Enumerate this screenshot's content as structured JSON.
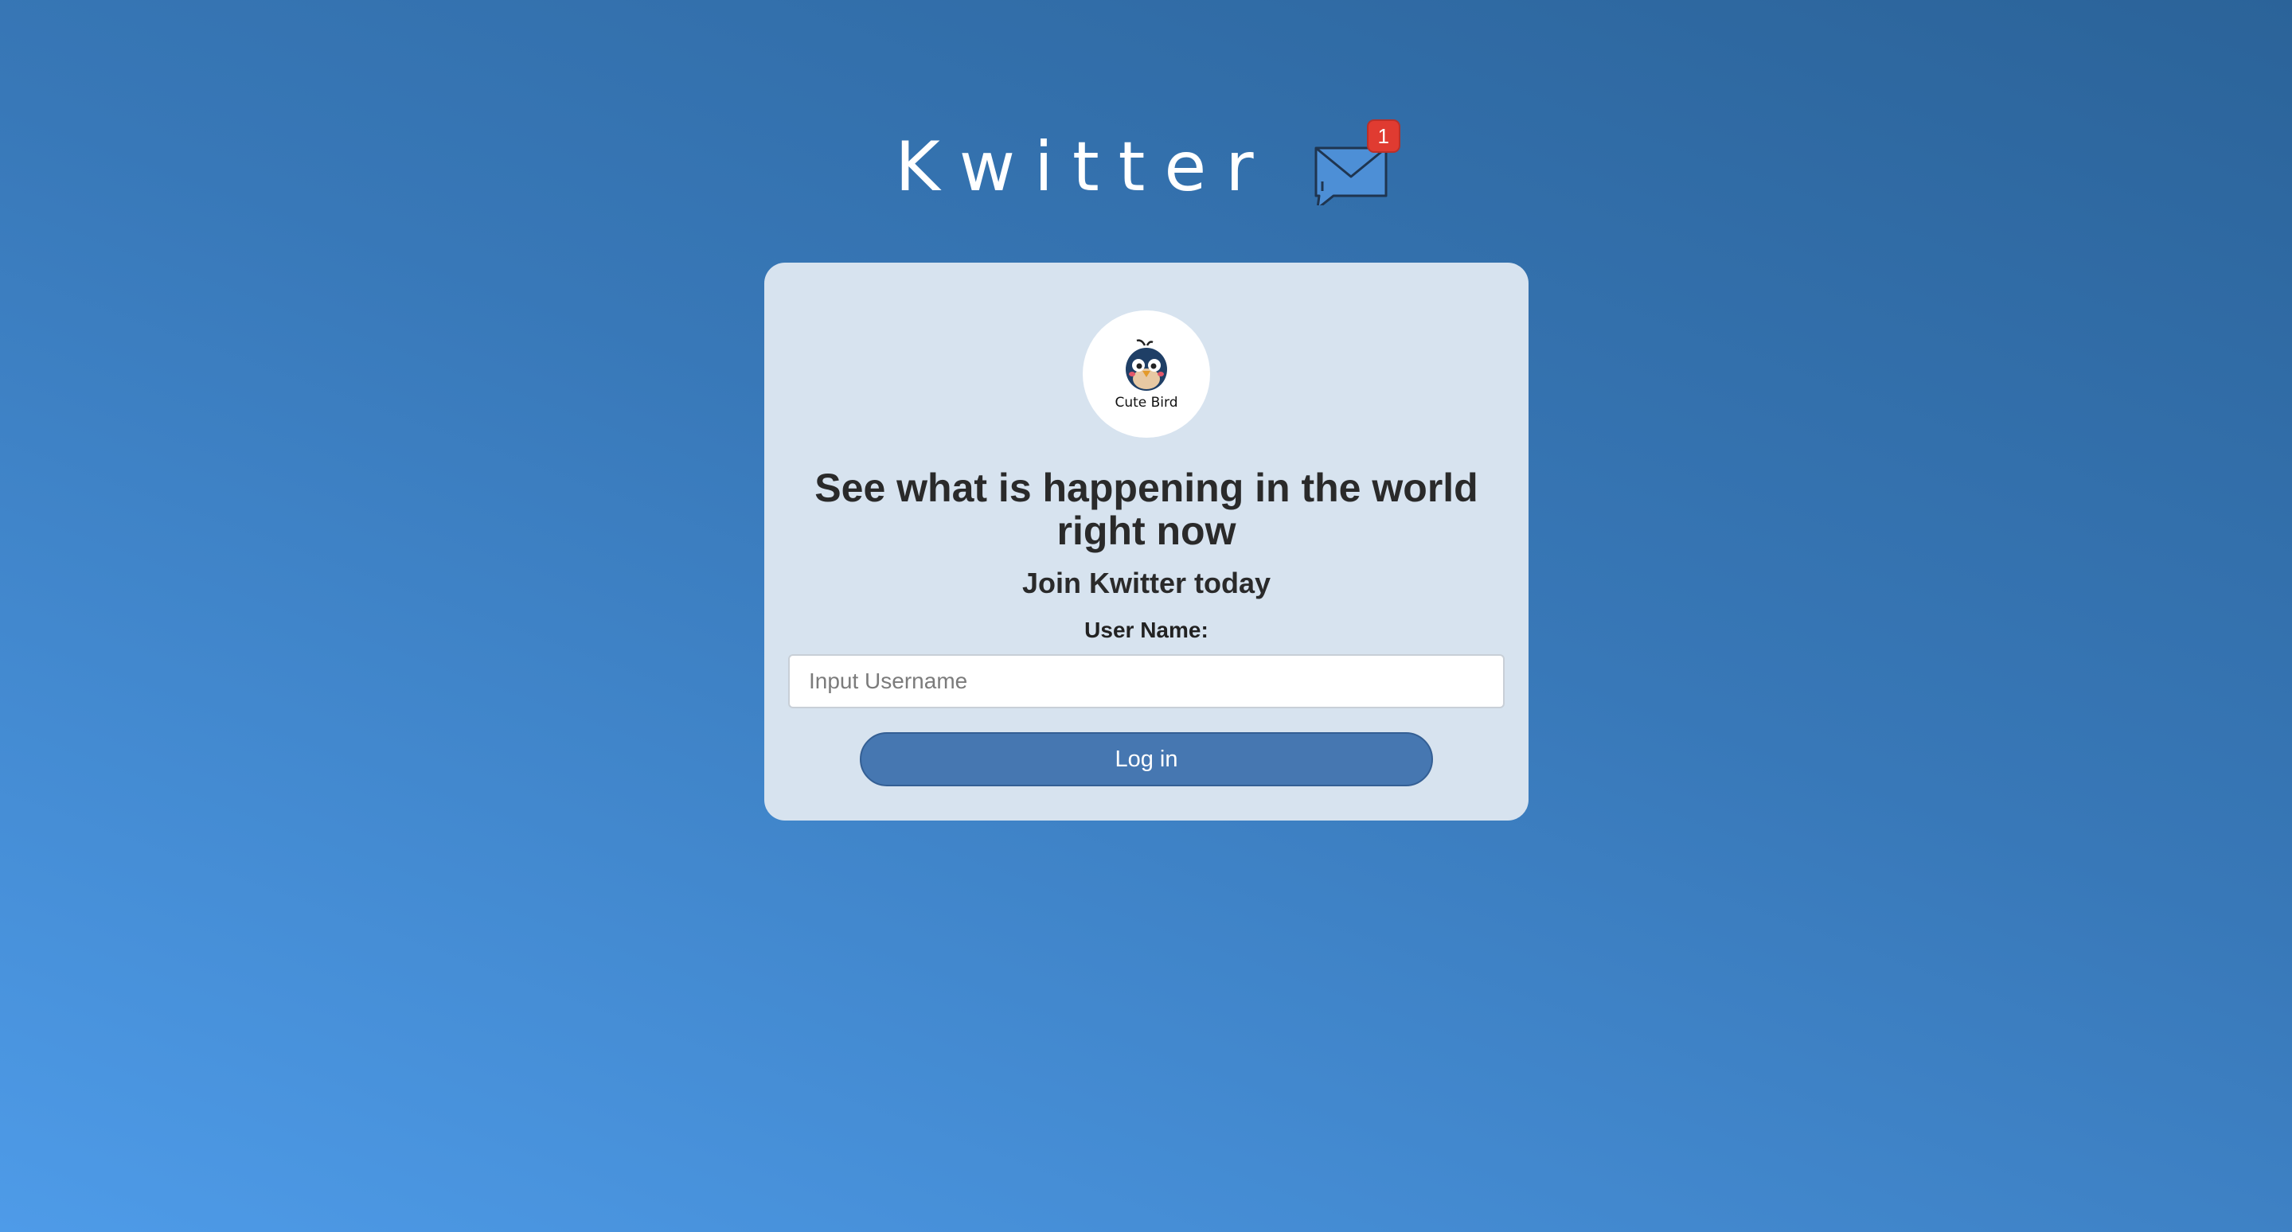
{
  "header": {
    "app_title": "Kwitter",
    "notification_count": "1"
  },
  "card": {
    "avatar_caption": "Cute Bird",
    "headline": "See what is happening in the world right now",
    "subheadline": "Join Kwitter today",
    "username_label": "User Name:",
    "username_placeholder": "Input Username",
    "username_value": "",
    "login_label": "Log in"
  },
  "colors": {
    "background_gradient_start": "#2b6399",
    "background_gradient_end": "#4e9be8",
    "card_background": "#d7e3ef",
    "button_background": "#4677b1",
    "badge": "#e03b31"
  }
}
